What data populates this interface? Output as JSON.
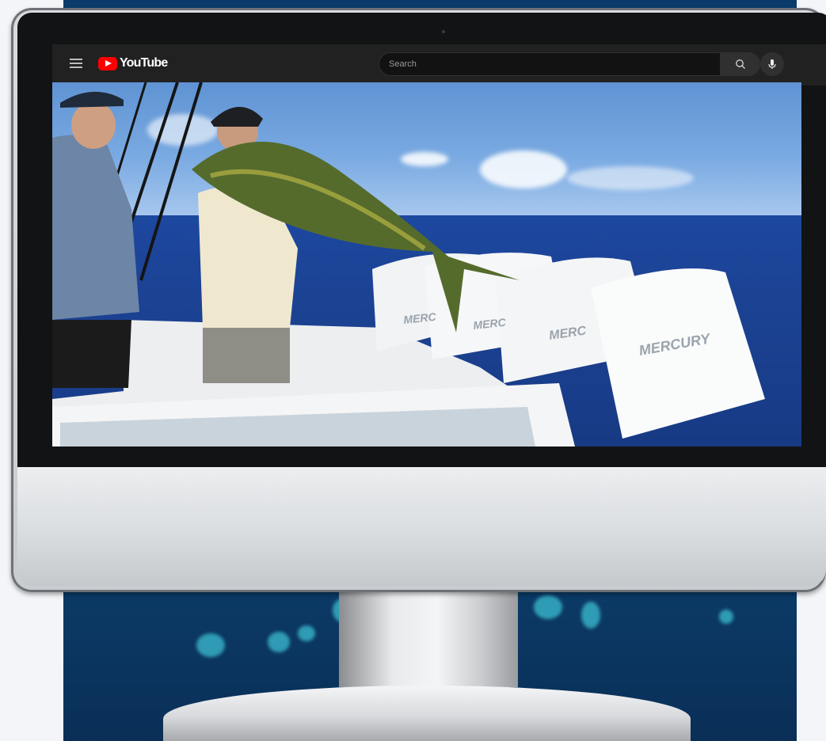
{
  "app": {
    "logo_text": "YouTube"
  },
  "search": {
    "placeholder": "Search"
  },
  "icons": {
    "menu": "hamburger-icon",
    "logo": "youtube-logo-icon",
    "search": "search-icon",
    "voice": "microphone-icon"
  },
  "video": {
    "engine_label_1": "MERC",
    "engine_label_2": "MERC",
    "engine_label_3": "MERC",
    "engine_label_4": "MERCURY"
  },
  "colors": {
    "youtube_red": "#ff0000",
    "toolbar_bg": "#212121",
    "search_bg": "#121212",
    "background_blue": "#0b3a6a"
  }
}
